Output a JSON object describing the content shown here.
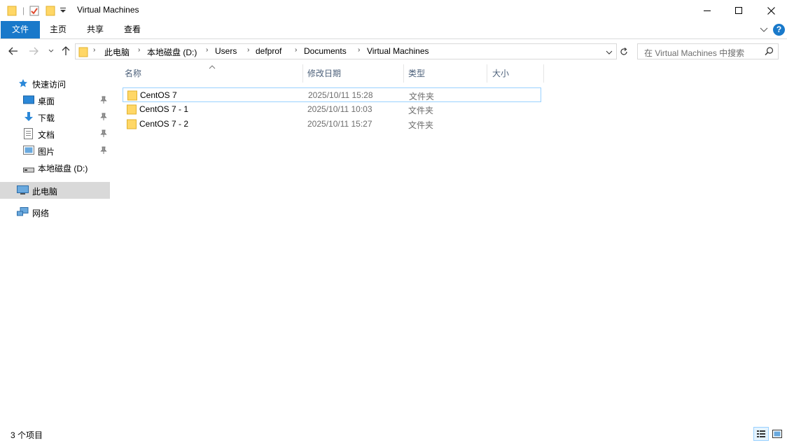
{
  "window": {
    "title": "Virtual Machines",
    "minimize_glyph": "—",
    "maximize_glyph": "☐",
    "close_glyph": "✕"
  },
  "ribbon": {
    "tabs": [
      {
        "label": "文件",
        "active": true
      },
      {
        "label": "主页"
      },
      {
        "label": "共享"
      },
      {
        "label": "查看"
      }
    ],
    "help_glyph": "?"
  },
  "address": {
    "breadcrumbs": [
      "此电脑",
      "本地磁盘 (D:)",
      "Users",
      "defprof",
      "Documents",
      "Virtual Machines"
    ],
    "search_placeholder": "在 Virtual Machines 中搜索"
  },
  "sidebar": {
    "quick_access": "快速访问",
    "items": [
      {
        "label": "桌面",
        "icon": "desktop-icon",
        "pinned": true
      },
      {
        "label": "下载",
        "icon": "download-icon",
        "pinned": true
      },
      {
        "label": "文档",
        "icon": "document-icon",
        "pinned": true
      },
      {
        "label": "图片",
        "icon": "picture-icon",
        "pinned": true
      },
      {
        "label": "本地磁盘 (D:)",
        "icon": "drive-icon",
        "pinned": false
      }
    ],
    "this_pc": "此电脑",
    "network": "网络"
  },
  "columns": {
    "name": "名称",
    "date": "修改日期",
    "type": "类型",
    "size": "大小"
  },
  "files": [
    {
      "name": "CentOS 7",
      "date": "2025/10/11 15:28",
      "type": "文件夹"
    },
    {
      "name": "CentOS 7 - 1",
      "date": "2025/10/11 10:03",
      "type": "文件夹"
    },
    {
      "name": "CentOS 7 - 2",
      "date": "2025/10/11 15:27",
      "type": "文件夹"
    }
  ],
  "status": {
    "item_count": "3 个项目"
  },
  "colors": {
    "accent": "#1979ca",
    "folder": "#ffd766",
    "selection_border": "#99d1ff",
    "sidebar_selected": "#d9d9d9"
  }
}
